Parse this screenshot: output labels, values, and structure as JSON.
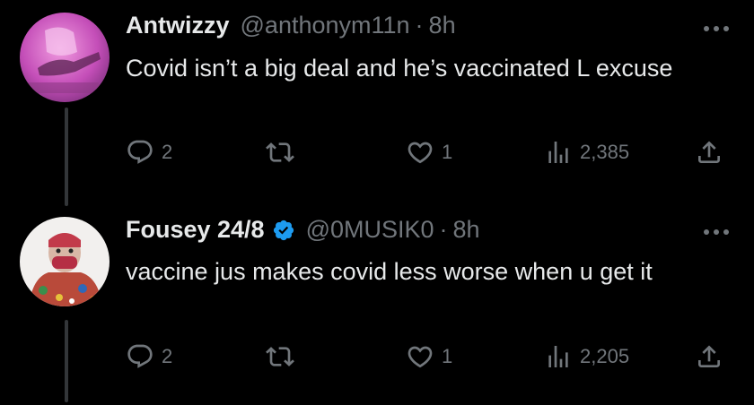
{
  "tweets": [
    {
      "name": "Antwizzy",
      "handle": "@anthonym11n",
      "separator": "·",
      "time": "8h",
      "verified": false,
      "text": "Covid isn’t a big deal and he’s vaccinated L excuse",
      "avatar_icon": "pink-photo-avatar",
      "stats": {
        "replies": "2",
        "retweets": "",
        "likes": "1",
        "views": "2,385"
      }
    },
    {
      "name": "Fousey 24/8",
      "handle": "@0MUSIK0",
      "separator": "·",
      "time": "8h",
      "verified": true,
      "text": "vaccine jus makes covid less worse when u get it",
      "avatar_icon": "masked-person-avatar",
      "stats": {
        "replies": "2",
        "retweets": "",
        "likes": "1",
        "views": "2,205"
      }
    }
  ],
  "colors": {
    "background": "#000000",
    "text": "#e7e9ea",
    "muted": "#71767b",
    "thread_line": "#333639",
    "verified_badge": "#1d9bf0"
  }
}
